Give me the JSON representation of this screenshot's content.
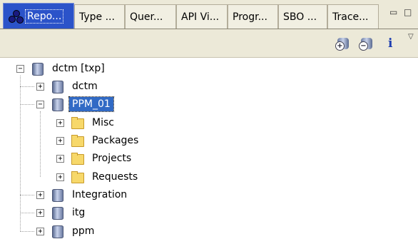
{
  "tabs": [
    {
      "label": "Repo...",
      "active": true
    },
    {
      "label": "Type ..."
    },
    {
      "label": "Quer..."
    },
    {
      "label": "API Vi..."
    },
    {
      "label": "Progr..."
    },
    {
      "label": "SBO ..."
    },
    {
      "label": "Trace..."
    }
  ],
  "window_controls": {
    "minimize": "▭",
    "maximize": "□"
  },
  "toolbar": {
    "info": "i",
    "menu": "▽",
    "add_badge": "+",
    "remove_badge": "−"
  },
  "tree": {
    "root": {
      "label": "dctm [txp]",
      "toggle": "−"
    },
    "repos": [
      {
        "label": "dctm",
        "toggle": "+"
      },
      {
        "label": "PPM_01",
        "toggle": "−",
        "selected": true
      },
      {
        "label": "Integration",
        "toggle": "+"
      },
      {
        "label": "itg",
        "toggle": "+"
      },
      {
        "label": "ppm",
        "toggle": "+"
      }
    ],
    "folders": [
      {
        "label": "Misc",
        "toggle": "+"
      },
      {
        "label": "Packages",
        "toggle": "+"
      },
      {
        "label": "Projects",
        "toggle": "+"
      },
      {
        "label": "Requests",
        "toggle": "+"
      }
    ]
  }
}
